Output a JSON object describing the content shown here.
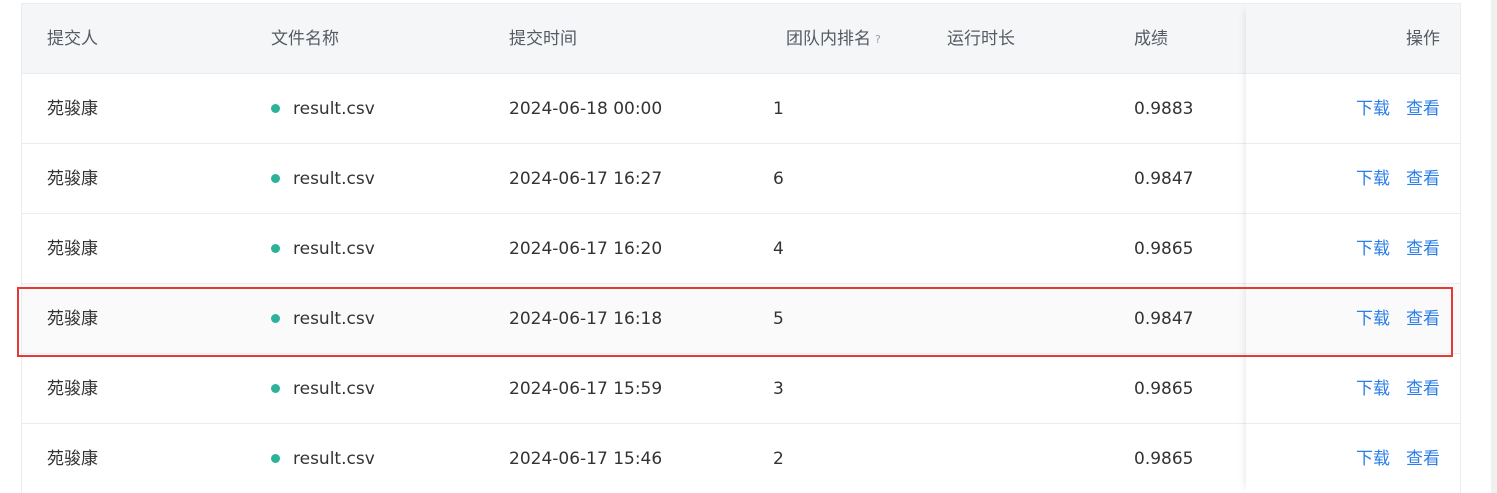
{
  "columns": {
    "submitter": "提交人",
    "file": "文件名称",
    "time": "提交时间",
    "rank": "团队内排名",
    "rank_help": "?",
    "runtime": "运行时长",
    "score": "成绩",
    "ops": "操作"
  },
  "rows": [
    {
      "submitter": "苑骏康",
      "file": "result.csv",
      "time": "2024-06-18 00:00",
      "rank": "1",
      "runtime": "",
      "score": "0.9883",
      "download": "下载",
      "view": "查看"
    },
    {
      "submitter": "苑骏康",
      "file": "result.csv",
      "time": "2024-06-17 16:27",
      "rank": "6",
      "runtime": "",
      "score": "0.9847",
      "download": "下载",
      "view": "查看"
    },
    {
      "submitter": "苑骏康",
      "file": "result.csv",
      "time": "2024-06-17 16:20",
      "rank": "4",
      "runtime": "",
      "score": "0.9865",
      "download": "下载",
      "view": "查看"
    },
    {
      "submitter": "苑骏康",
      "file": "result.csv",
      "time": "2024-06-17 16:18",
      "rank": "5",
      "runtime": "",
      "score": "0.9847",
      "download": "下载",
      "view": "查看"
    },
    {
      "submitter": "苑骏康",
      "file": "result.csv",
      "time": "2024-06-17 15:59",
      "rank": "3",
      "runtime": "",
      "score": "0.9865",
      "download": "下载",
      "view": "查看"
    },
    {
      "submitter": "苑骏康",
      "file": "result.csv",
      "time": "2024-06-17 15:46",
      "rank": "2",
      "runtime": "",
      "score": "0.9865",
      "download": "下载",
      "view": "查看"
    }
  ],
  "highlighted_row": 3,
  "colors": {
    "link": "#2a7ee8",
    "status_dot": "#2bb39a",
    "highlight_border": "#e53935",
    "header_bg": "#f5f6f8"
  }
}
